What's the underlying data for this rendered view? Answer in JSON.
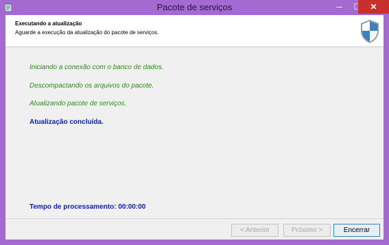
{
  "window": {
    "title": "Pacote de serviços",
    "close_glyph": "✕",
    "min_glyph": "─",
    "max_glyph": "☐"
  },
  "header": {
    "title": "Executando a atualização",
    "subtitle": "Aguarde a execução da atualização do pacote de serviços.",
    "icon": "shield-icon"
  },
  "steps": [
    "Iniciando a conexão com o banco de dados.",
    "Descompactando os arquivos do pacote.",
    "Atualizando pacote de serviços."
  ],
  "status": {
    "done": "Atualização concluída."
  },
  "timing": {
    "label": "Tempo de processamento:",
    "value": "00:00:00"
  },
  "buttons": {
    "back": "< Anterior",
    "next": "Próximo >",
    "close": "Encerrar"
  },
  "colors": {
    "accent": "#a46ad2",
    "success": "#2e8b1c",
    "info": "#0b1db5",
    "close": "#c7302c"
  }
}
